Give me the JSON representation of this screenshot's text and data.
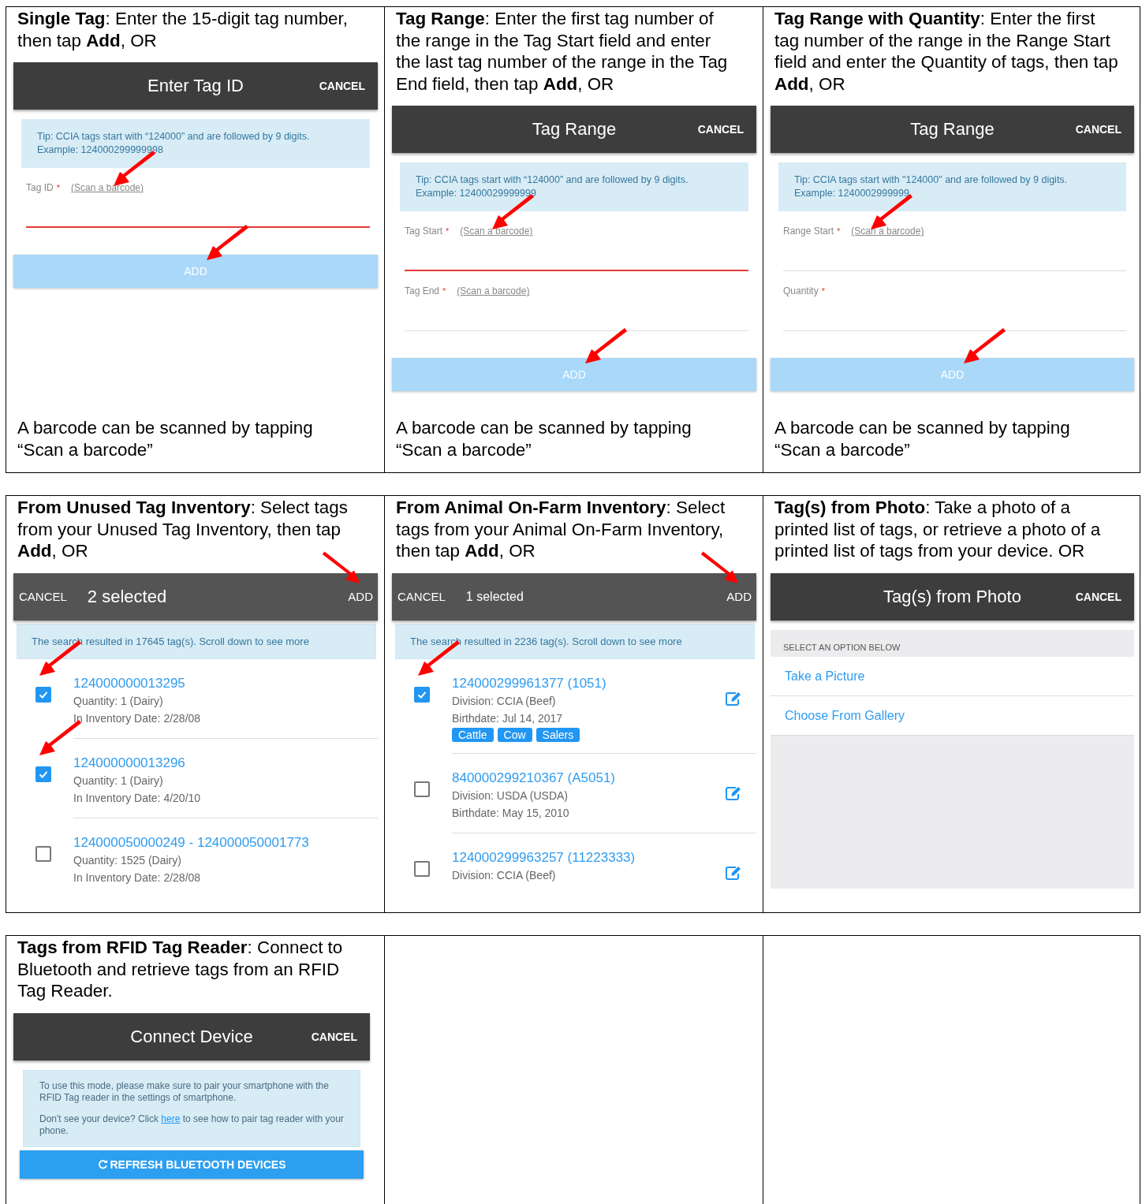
{
  "rows": [
    {
      "cells": [
        {
          "intro": "**Single Tag**: Enter the 15-digit tag number, then tap **Add**, OR",
          "screen": {
            "kind": "form",
            "title": "Enter Tag ID",
            "cancel": "CANCEL",
            "tip": [
              "Tip: CCIA tags start with “124000” and are followed by 9 digits.",
              "Example: 124000299999998"
            ],
            "fields": [
              {
                "label": "Tag ID",
                "required": "*",
                "scan": "(Scan a barcode)",
                "focused": true,
                "marked": true
              }
            ],
            "add": "ADD",
            "add_marked": true
          },
          "caption": "A barcode can be scanned by tapping “Scan a barcode”"
        },
        {
          "intro": "**Tag Range**: Enter the first tag number of the range in the Tag Start field and enter the last tag number of the range in the Tag End field, then tap **Add**, OR",
          "screen": {
            "kind": "form",
            "title": "Tag Range",
            "cancel": "CANCEL",
            "tip": [
              "Tip: CCIA tags start with “124000” and are followed by 9 digits.",
              "Example: 12400029999999"
            ],
            "fields": [
              {
                "label": "Tag Start",
                "required": "*",
                "scan": "(Scan a barcode)",
                "focused": true,
                "marked": true
              },
              {
                "label": "Tag End",
                "required": "*",
                "scan": "(Scan a barcode)",
                "focused": false,
                "marked": false
              }
            ],
            "add": "ADD",
            "add_marked": true
          },
          "caption": "A barcode can be scanned by tapping “Scan a barcode”"
        },
        {
          "intro": "**Tag Range with Quantity**: Enter the first tag number of the range in the Range Start field and enter the Quantity of tags, then tap **Add**, OR",
          "screen": {
            "kind": "form",
            "title": "Tag Range",
            "cancel": "CANCEL",
            "tip": [
              "Tip: CCIA tags start with \"124000\" and are followed by 9 digits.",
              "Example: 1240002999999"
            ],
            "fields": [
              {
                "label": "Range Start",
                "required": "*",
                "scan": "(Scan a barcode)",
                "focused": false,
                "marked": true
              },
              {
                "label": "Quantity",
                "required": "*",
                "focused": false,
                "marked": false
              }
            ],
            "add": "ADD",
            "add_marked": true
          },
          "caption": "A barcode can be scanned by tapping “Scan a barcode”"
        }
      ]
    },
    {
      "cells": [
        {
          "intro": "**From Unused Tag Inventory**: Select tags from your Unused Tag Inventory, then tap **Add**, OR",
          "screen": {
            "kind": "list",
            "cancel": "CANCEL",
            "title": "2 selected",
            "add": "ADD",
            "add_marked": true,
            "notice": "The search resulted in 17645 tag(s). Scroll down to see more",
            "items": [
              {
                "title": "124000000013295",
                "lines": [
                  "Quantity: 1 (Dairy)",
                  "In Inventory Date: 2/28/08"
                ],
                "checked": true,
                "marked": true
              },
              {
                "title": "124000000013296",
                "lines": [
                  "Quantity: 1 (Dairy)",
                  "In Inventory Date: 4/20/10"
                ],
                "checked": true,
                "marked": true
              },
              {
                "title": "124000050000249 - 124000050001773",
                "lines": [
                  "Quantity: 1525 (Dairy)",
                  "In Inventory Date: 2/28/08"
                ],
                "checked": false,
                "marked": false
              }
            ]
          }
        },
        {
          "intro": "**From Animal On-Farm Inventory**: Select tags from your Animal On-Farm Inventory, then tap **Add**, OR",
          "screen": {
            "kind": "list",
            "cancel": "CANCEL",
            "title": "1 selected",
            "add": "ADD",
            "add_marked": true,
            "notice": "The search resulted in 2236 tag(s). Scroll down to see more",
            "items": [
              {
                "title": "124000299961377 (1051)",
                "lines": [
                  "Division: CCIA (Beef)",
                  "Birthdate: Jul 14, 2017"
                ],
                "chips": [
                  "Cattle",
                  "Cow",
                  "Salers"
                ],
                "editable": true,
                "checked": true,
                "marked": true
              },
              {
                "title": "840000299210367 (A5051)",
                "lines": [
                  "Division: USDA (USDA)",
                  "Birthdate: May 15, 2010"
                ],
                "editable": true,
                "checked": false,
                "marked": false
              },
              {
                "title": "124000299963257 (11223333)",
                "lines": [
                  "Division: CCIA (Beef)"
                ],
                "editable": true,
                "checked": false,
                "marked": false
              }
            ]
          }
        },
        {
          "intro": "**Tag(s) from Photo**: Take a photo of a printed list of tags, or retrieve a photo of a printed list of tags from your device. OR",
          "screen": {
            "kind": "options",
            "title": "Tag(s) from Photo",
            "cancel": "CANCEL",
            "section": "SELECT AN OPTION BELOW",
            "options": [
              "Take a Picture",
              "Choose From Gallery"
            ]
          }
        }
      ]
    },
    {
      "cells": [
        {
          "intro": "**Tags from RFID Tag Reader**: Connect to Bluetooth and retrieve tags from an RFID Tag Reader.",
          "screen": {
            "kind": "connect",
            "title": "Connect Device",
            "cancel": "CANCEL",
            "paragraph": "To use this mode, please make sure to pair your smartphone with the RFID Tag reader in the settings of smartphone.",
            "help_before": "Don't see your device? Click ",
            "help_link": "here",
            "help_after": " to see how to pair tag reader with your phone.",
            "button": "REFRESH BLUETOOTH DEVICES"
          }
        }
      ]
    }
  ]
}
